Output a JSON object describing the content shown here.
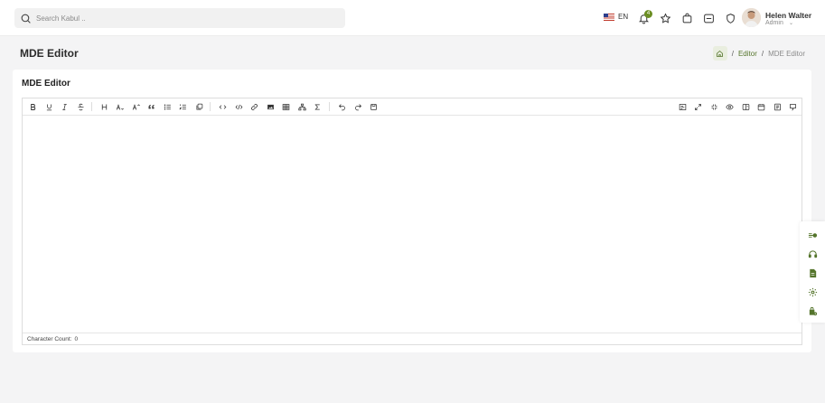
{
  "search": {
    "placeholder": "Search Kabul .."
  },
  "header": {
    "language": "EN",
    "notification_count": "4",
    "user": {
      "name": "Helen Walter",
      "role": "Admin"
    }
  },
  "page": {
    "title": "MDE Editor",
    "breadcrumb": {
      "link": "Editor",
      "separator": "/",
      "current": "MDE Editor"
    }
  },
  "card": {
    "title": "MDE Editor"
  },
  "editor": {
    "toolbar_left": [
      "bold-icon",
      "underline-icon",
      "italic-icon",
      "strikethrough-icon",
      "heading-icon",
      "heading-smaller-icon",
      "heading-bigger-icon",
      "quote-icon",
      "unordered-list-icon",
      "ordered-list-icon",
      "clean-block-icon",
      "code-icon",
      "inline-code-icon",
      "link-icon",
      "image-icon",
      "table-icon",
      "diagram-icon",
      "formula-icon",
      "undo-icon",
      "redo-icon",
      "save-icon"
    ],
    "toolbar_right": [
      "preview-mode-icon",
      "fullscreen-icon",
      "exit-fullscreen-icon",
      "preview-icon",
      "side-by-side-icon",
      "calendar-icon",
      "document-icon",
      "guide-icon"
    ],
    "status_label": "Character Count:",
    "character_count": "0"
  },
  "floating": [
    "customizer-icon",
    "support-icon",
    "docs-icon",
    "settings-icon",
    "buy-icon"
  ],
  "colors": {
    "accent": "#55752c",
    "bg": "#f4f4f5",
    "badge": "#6b8e23"
  }
}
